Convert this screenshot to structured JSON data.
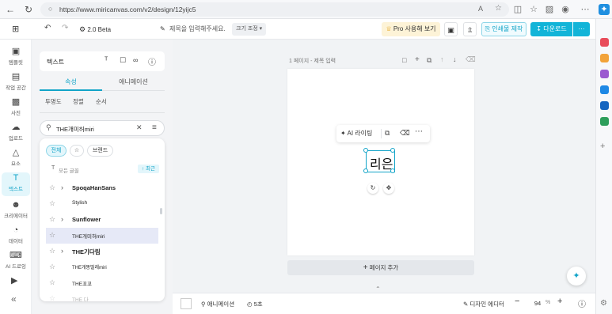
{
  "browser": {
    "url": "https://www.miricanvas.com/v2/design/12yijc5"
  },
  "header": {
    "version_label": "2.0 Beta",
    "title_placeholder": "제목을 입력해주세요.",
    "size_label": "크기 조정",
    "pro_label": "Pro 사용해 보기",
    "print_label": "인쇄물 제작",
    "download_label": "다운로드"
  },
  "rail": {
    "items": [
      {
        "label": "템플릿",
        "icon": "template-icon"
      },
      {
        "label": "작업 공간",
        "icon": "workspace-icon"
      },
      {
        "label": "사진",
        "icon": "photo-icon"
      },
      {
        "label": "업로드",
        "icon": "upload-icon"
      },
      {
        "label": "요소",
        "icon": "elements-icon"
      },
      {
        "label": "텍스트",
        "icon": "text-icon"
      },
      {
        "label": "크리에이터",
        "icon": "creator-icon"
      },
      {
        "label": "데이터",
        "icon": "data-icon"
      },
      {
        "label": "AI 드로잉",
        "icon": "ai-drawing-icon"
      }
    ]
  },
  "panel": {
    "head_label": "텍스트",
    "tabs": [
      "속성",
      "애니메이션"
    ],
    "subtabs": [
      "투명도",
      "정렬",
      "순서"
    ],
    "search_value": "THE개미허miri",
    "chips": [
      "전체",
      "브랜드"
    ],
    "all_fonts_label": "모든 글꼴",
    "recent_label": "최근",
    "fonts": [
      {
        "name": "SpoqaHanSans",
        "expand": true,
        "bold": true
      },
      {
        "name": "Stylish",
        "expand": false,
        "bold": false
      },
      {
        "name": "Sunflower",
        "expand": true,
        "bold": true
      },
      {
        "name": "THE개미허miri",
        "expand": false,
        "bold": false
      },
      {
        "name": "THE기다림",
        "expand": true,
        "bold": true
      },
      {
        "name": "THE개똥벌레miri",
        "expand": false,
        "bold": false
      },
      {
        "name": "THE꼬꼬",
        "expand": false,
        "bold": false
      },
      {
        "name": "THE 다",
        "expand": false,
        "bold": false
      }
    ]
  },
  "canvas": {
    "page_label": "1 페이지 - 제목 입력",
    "ai_label": "AI 라이팅",
    "text_content": "리은",
    "add_page_label": "페이지 추가"
  },
  "bottom": {
    "animation_label": "애니메이션",
    "duration_label": "5초",
    "design_editor_label": "디자인 에디터",
    "zoom_value": "94",
    "zoom_unit": "%"
  },
  "colors": {
    "accent": "#12a4c8",
    "accent_bg": "#e3f6fb",
    "selected_row": "#e6e9f7"
  }
}
